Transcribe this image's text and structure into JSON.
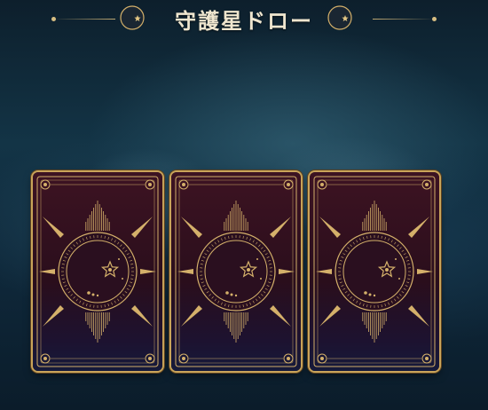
{
  "header": {
    "title": "守護星ドロー",
    "left_emblem_icon": "crescent-moon-star-icon",
    "right_emblem_icon": "crescent-moon-star-icon"
  },
  "cards": [
    {
      "face": "back",
      "emblem_icon": "crescent-moon-star-icon"
    },
    {
      "face": "back",
      "emblem_icon": "crescent-moon-star-icon"
    },
    {
      "face": "back",
      "emblem_icon": "crescent-moon-star-icon"
    }
  ],
  "colors": {
    "gold": "#d4b06a",
    "card_top": "#3d1322",
    "card_bottom": "#151a3a",
    "title_text": "#efe6cf"
  }
}
